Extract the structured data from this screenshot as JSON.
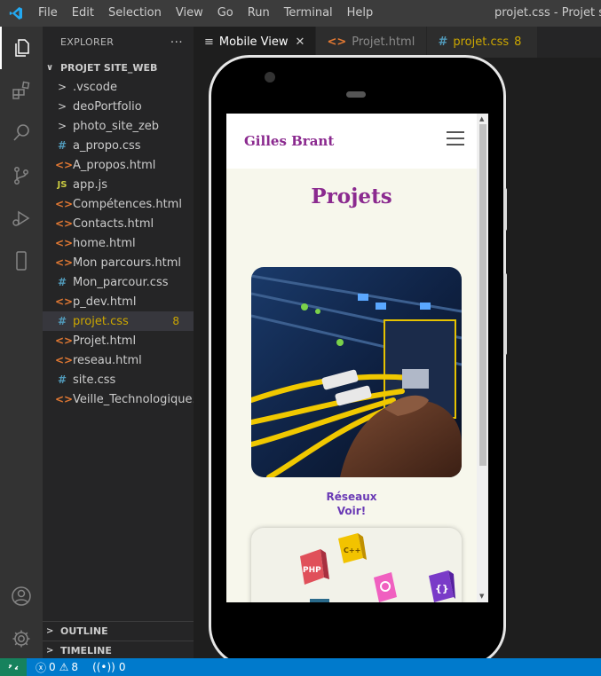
{
  "window": {
    "title": "projet.css - Projet site_w",
    "menu": [
      "File",
      "Edit",
      "Selection",
      "View",
      "Go",
      "Run",
      "Terminal",
      "Help"
    ]
  },
  "activity_bar": {
    "icons": [
      "explorer-icon",
      "extensions-icon",
      "search-icon",
      "source-control-icon",
      "run-debug-icon",
      "mobile-view-icon",
      "account-icon",
      "settings-gear-icon"
    ]
  },
  "explorer": {
    "header": "EXPLORER",
    "more": "···",
    "folder": "PROJET SITE_WEB",
    "items": [
      {
        "label": ".vscode",
        "type": "folder"
      },
      {
        "label": "deoPortfolio",
        "type": "folder"
      },
      {
        "label": "photo_site_zeb",
        "type": "folder"
      },
      {
        "label": "a_propo.css",
        "type": "css"
      },
      {
        "label": "A_propos.html",
        "type": "html"
      },
      {
        "label": "app.js",
        "type": "js"
      },
      {
        "label": "Compétences.html",
        "type": "html"
      },
      {
        "label": "Contacts.html",
        "type": "html"
      },
      {
        "label": "home.html",
        "type": "html"
      },
      {
        "label": "Mon parcours.html",
        "type": "html"
      },
      {
        "label": "Mon_parcour.css",
        "type": "css"
      },
      {
        "label": "p_dev.html",
        "type": "html"
      },
      {
        "label": "projet.css",
        "type": "css",
        "badge": "8",
        "selected": true
      },
      {
        "label": "Projet.html",
        "type": "html"
      },
      {
        "label": "reseau.html",
        "type": "html"
      },
      {
        "label": "site.css",
        "type": "css"
      },
      {
        "label": "Veille_Technologique....",
        "type": "html"
      }
    ],
    "outline": "OUTLINE",
    "timeline": "TIMELINE"
  },
  "tabs": [
    {
      "label": "Mobile View",
      "icon": "≡",
      "active": true,
      "close": "✕"
    },
    {
      "label": "Projet.html",
      "icon": "<>",
      "active": false
    },
    {
      "label": "projet.css",
      "icon": "#",
      "active": false,
      "modified": "8"
    }
  ],
  "preview": {
    "brand": "Gilles Brant",
    "page_title": "Projets",
    "cards": [
      {
        "caption_line1": "Réseaux",
        "caption_line2": "Voir!"
      }
    ],
    "badges": [
      "PHP",
      "C++",
      "{}"
    ]
  },
  "status": {
    "errors": "0",
    "warnings": "8",
    "ports": "0"
  },
  "colors": {
    "accent_purple": "#8b2a8f",
    "caption_purple": "#6a3ab5",
    "status_blue": "#007acc"
  }
}
